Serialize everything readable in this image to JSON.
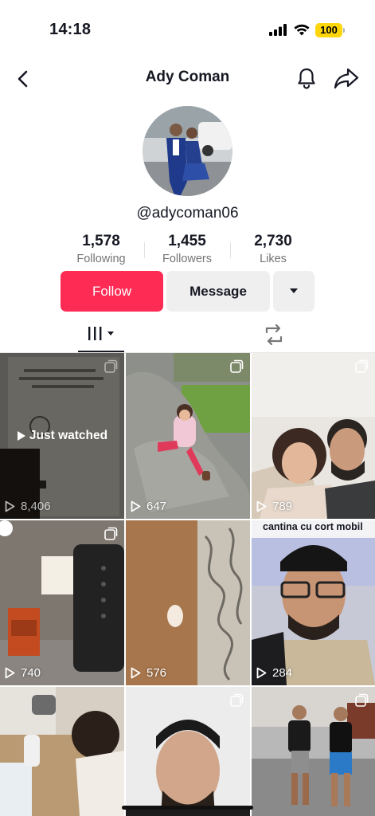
{
  "status_bar": {
    "time": "14:18",
    "battery": "100"
  },
  "header": {
    "title": "Ady Coman"
  },
  "profile": {
    "username": "@adycoman06",
    "stats": [
      {
        "value": "1,578",
        "label": "Following"
      },
      {
        "value": "1,455",
        "label": "Followers"
      },
      {
        "value": "2,730",
        "label": "Likes"
      }
    ]
  },
  "actions": {
    "follow": "Follow",
    "message": "Message"
  },
  "grid": {
    "just_watched": "Just watched",
    "tiles": [
      {
        "views": "8,406"
      },
      {
        "views": "647"
      },
      {
        "views": "789"
      },
      {
        "views": "740"
      },
      {
        "views": "576"
      },
      {
        "views": "284",
        "caption": "cantina cu cort mobil"
      },
      {
        "views": ""
      },
      {
        "views": ""
      },
      {
        "views": ""
      }
    ]
  },
  "icons": [
    "back-icon",
    "bell-icon",
    "share-icon",
    "grid-icon",
    "repost-icon",
    "play-icon",
    "multi-photo-icon"
  ],
  "colors": {
    "follow": "#fe2c55",
    "secondary_button": "#efeff0",
    "text": "#161823",
    "muted": "#757575"
  }
}
